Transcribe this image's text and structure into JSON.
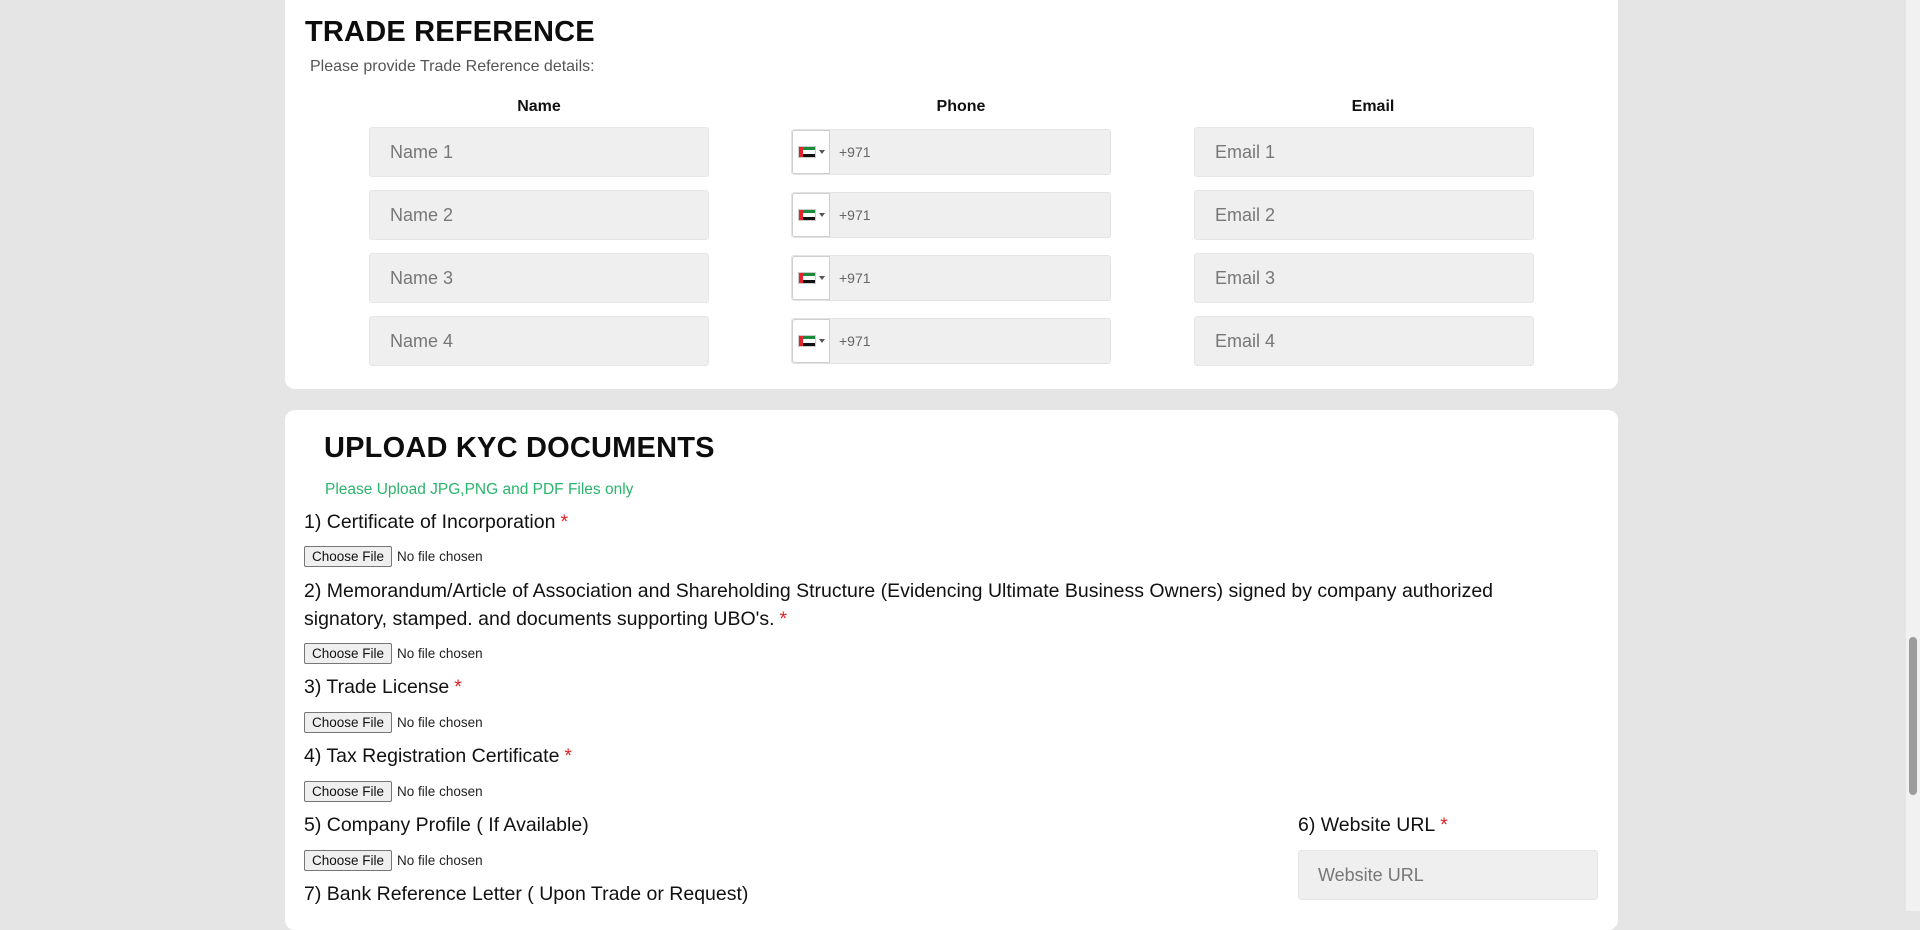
{
  "trade_reference": {
    "title": "TRADE REFERENCE",
    "subtitle": "Please provide Trade Reference details:",
    "columns": {
      "name": "Name",
      "phone": "Phone",
      "email": "Email"
    },
    "rows": [
      {
        "name_placeholder": "Name 1",
        "dial_code": "+971",
        "email_placeholder": "Email 1"
      },
      {
        "name_placeholder": "Name 2",
        "dial_code": "+971",
        "email_placeholder": "Email 2"
      },
      {
        "name_placeholder": "Name 3",
        "dial_code": "+971",
        "email_placeholder": "Email 3"
      },
      {
        "name_placeholder": "Name 4",
        "dial_code": "+971",
        "email_placeholder": "Email 4"
      }
    ],
    "flag": {
      "red": "#e3262b",
      "green": "#1b8a3a",
      "white": "#ffffff",
      "black": "#111111",
      "icon": "uae-flag-icon"
    }
  },
  "kyc": {
    "title": "UPLOAD KYC DOCUMENTS",
    "note": "Please Upload JPG,PNG and PDF Files only",
    "note_color": "#2bb46b",
    "required_mark": "*",
    "choose_file_label": "Choose File",
    "no_file_text": "No file chosen",
    "documents": [
      {
        "label": "1) Certificate of Incorporation",
        "required": true
      },
      {
        "label_line1": "2) Memorandum/Article of Association and Shareholding Structure (Evidencing Ultimate Business Owners) signed by company authorized",
        "label_line2": "signatory, stamped. and documents supporting UBO's.",
        "required": true
      },
      {
        "label": "3) Trade License",
        "required": true
      },
      {
        "label": "4) Tax Registration Certificate",
        "required": true
      },
      {
        "label": "5) Company Profile ( If Available)",
        "required": false
      },
      {
        "label": "7) Bank Reference Letter ( Upon Trade or Request)",
        "required": false
      }
    ],
    "website": {
      "label": "6) Website URL",
      "placeholder": "Website URL",
      "required": true
    }
  },
  "colors": {
    "page_bg": "#e5e5e5",
    "card_bg": "#ffffff",
    "input_bg": "#efefef",
    "required": "#e02424"
  }
}
